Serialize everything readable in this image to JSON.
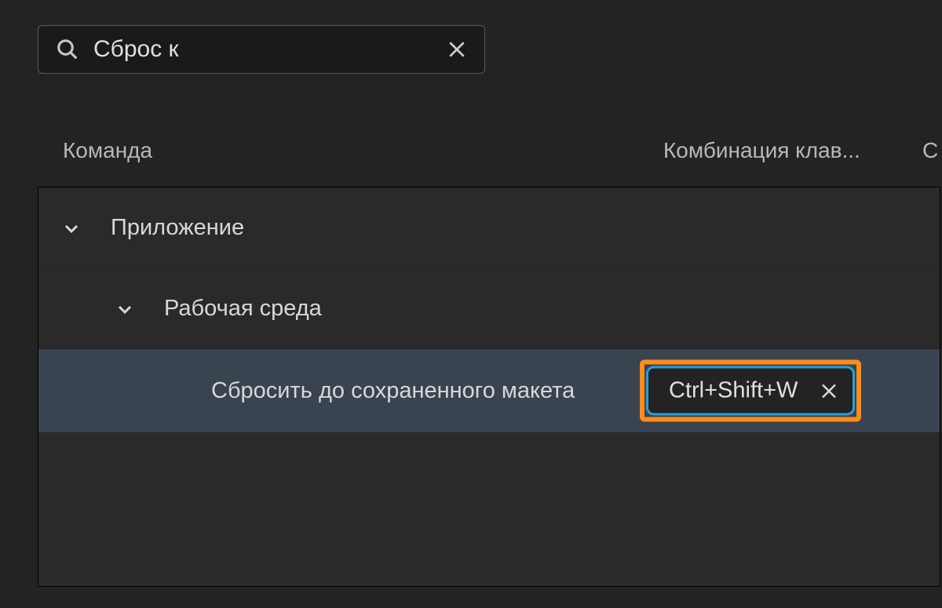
{
  "search": {
    "value": "Сброс к"
  },
  "columns": {
    "command": "Команда",
    "shortcut": "Комбинация клав...",
    "extra": "С"
  },
  "tree": {
    "level0": {
      "label": "Приложение"
    },
    "level1": {
      "label": "Рабочая среда"
    },
    "level2": {
      "label": "Сбросить до сохраненного макета",
      "shortcut": "Ctrl+Shift+W"
    }
  }
}
